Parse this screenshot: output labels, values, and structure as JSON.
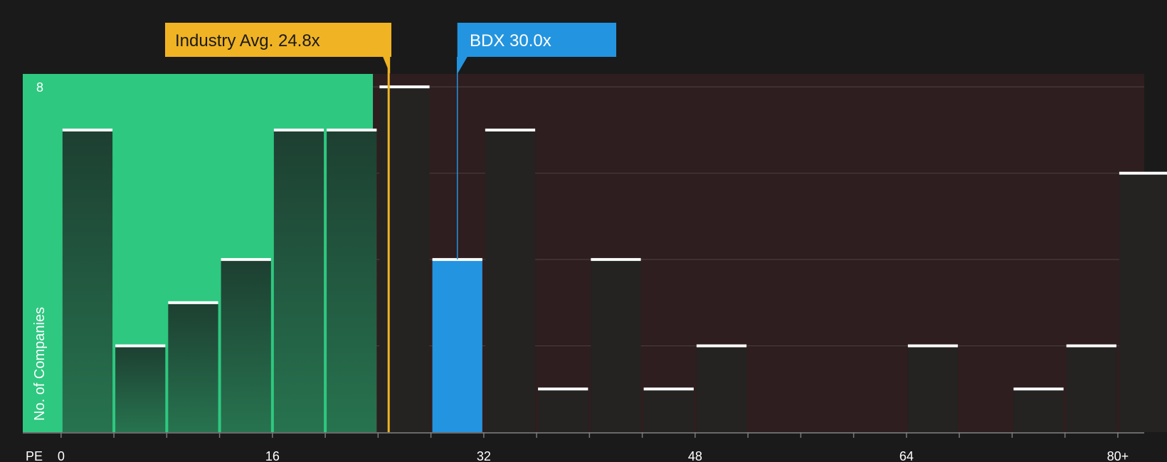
{
  "chart_data": {
    "type": "bar",
    "xlabel": "PE",
    "ylabel": "No. of Companies",
    "x_tick_labels": [
      "0",
      "16",
      "32",
      "48",
      "64",
      "80+"
    ],
    "x_tick_values": [
      0,
      16,
      32,
      48,
      64,
      80
    ],
    "y_tick_labels": [
      "8"
    ],
    "y_tick_values": [
      8
    ],
    "xlim": [
      -2.9,
      82
    ],
    "ylim": [
      0,
      8.3
    ],
    "bin_width": 4,
    "bins": [
      {
        "start": 0,
        "count": 7
      },
      {
        "start": 4,
        "count": 2
      },
      {
        "start": 8,
        "count": 3
      },
      {
        "start": 12,
        "count": 4
      },
      {
        "start": 16,
        "count": 7
      },
      {
        "start": 20,
        "count": 7
      },
      {
        "start": 24,
        "count": 8
      },
      {
        "start": 28,
        "count": 4,
        "highlight": true
      },
      {
        "start": 32,
        "count": 7
      },
      {
        "start": 36,
        "count": 1
      },
      {
        "start": 40,
        "count": 4
      },
      {
        "start": 44,
        "count": 1
      },
      {
        "start": 48,
        "count": 2
      },
      {
        "start": 52,
        "count": 0
      },
      {
        "start": 56,
        "count": 0
      },
      {
        "start": 60,
        "count": 0
      },
      {
        "start": 64,
        "count": 2
      },
      {
        "start": 68,
        "count": 0
      },
      {
        "start": 72,
        "count": 1
      },
      {
        "start": 76,
        "count": 2
      },
      {
        "start": 80,
        "count": 6
      }
    ],
    "markers": {
      "industry": {
        "label": "Industry Avg. 24.8x",
        "value": 24.8,
        "color": "#f0b323"
      },
      "company": {
        "label": "BDX 30.0x",
        "value": 30.0,
        "color": "#2394e0"
      }
    },
    "colors": {
      "background": "#1a1a1a",
      "below_region": "#2ec880",
      "above_region": "#2e1e1f",
      "bar_below": "#1f4a37",
      "bar_above": "#252222",
      "bar_highlight": "#2394e0",
      "cap": "#ffffff",
      "grid": "#4a3c3c"
    },
    "grid": true
  }
}
